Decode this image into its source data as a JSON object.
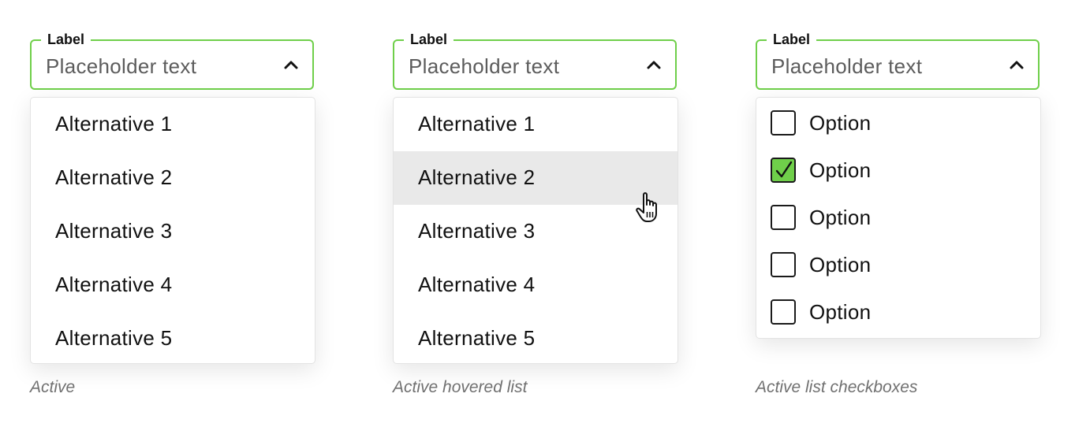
{
  "accent_color": "#6fcf4a",
  "hover_color": "#e9e9e9",
  "dropdowns": [
    {
      "label": "Label",
      "placeholder": "Placeholder text",
      "chevron_icon": "chevron-up-icon",
      "items": [
        "Alternative 1",
        "Alternative 2",
        "Alternative 3",
        "Alternative 4",
        "Alternative 5"
      ],
      "caption": "Active"
    },
    {
      "label": "Label",
      "placeholder": "Placeholder text",
      "chevron_icon": "chevron-up-icon",
      "items": [
        "Alternative 1",
        "Alternative 2",
        "Alternative 3",
        "Alternative 4",
        "Alternative 5"
      ],
      "hovered_item": "Alternative 2",
      "cursor_icon": "hand-pointer-icon",
      "caption": "Active hovered list"
    },
    {
      "label": "Label",
      "placeholder": "Placeholder text",
      "chevron_icon": "chevron-up-icon",
      "options": [
        {
          "label": "Option",
          "checked": false
        },
        {
          "label": "Option",
          "checked": true
        },
        {
          "label": "Option",
          "checked": false
        },
        {
          "label": "Option",
          "checked": false
        },
        {
          "label": "Option",
          "checked": false
        }
      ],
      "caption": "Active list checkboxes"
    }
  ]
}
